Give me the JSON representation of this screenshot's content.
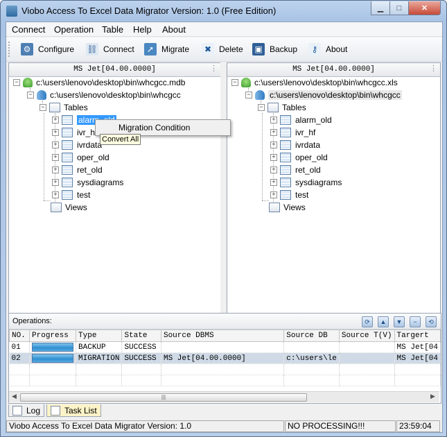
{
  "window": {
    "title": "Viobo Access To Excel Data Migrator Version: 1.0  (Free Edition)",
    "min_glyph": "▁",
    "max_glyph": "□",
    "close_glyph": "✕"
  },
  "menu": [
    "Connect",
    "Operation",
    "Table",
    "Help",
    "About"
  ],
  "toolbar": [
    {
      "label": "Configure",
      "icon": "gear-icon",
      "glyph": "⚙"
    },
    {
      "label": "Connect",
      "icon": "link-icon",
      "glyph": "⛓"
    },
    {
      "label": "Migrate",
      "icon": "migrate-icon",
      "glyph": "➚"
    },
    {
      "label": "Delete",
      "icon": "delete-icon",
      "glyph": "✖"
    },
    {
      "label": "Backup",
      "icon": "disk-icon",
      "glyph": "▣"
    },
    {
      "label": "About",
      "icon": "key-icon",
      "glyph": "⚷"
    }
  ],
  "left_panel": {
    "header": "MS Jet[04.00.0000]",
    "root": "c:\\users\\lenovo\\desktop\\bin\\whcgcc.mdb",
    "db": "c:\\users\\lenovo\\desktop\\bin\\whcgcc",
    "tables_label": "Tables",
    "tables": [
      "alarm_old",
      "ivr_hf",
      "ivrdata",
      "oper_old",
      "ret_old",
      "sysdiagrams",
      "test"
    ],
    "visible_tables": [
      "alarm_old",
      "ivr_hf",
      "ivrdata",
      "oper_old",
      "ret_old",
      "sysdiagrams",
      "test"
    ],
    "views_label": "Views"
  },
  "right_panel": {
    "header": "MS Jet[04.00.0000]",
    "root": "c:\\users\\lenovo\\desktop\\bin\\whcgcc.xls",
    "db": "c:\\users\\lenovo\\desktop\\bin\\whcgcc",
    "tables_label": "Tables",
    "tables": [
      "alarm_old",
      "ivr_hf",
      "ivrdata",
      "oper_old",
      "ret_old",
      "sysdiagrams",
      "test"
    ],
    "views_label": "Views"
  },
  "context_menu": {
    "item": "Migration Condition"
  },
  "tooltip": "Convert All",
  "operations": {
    "title": "Operations:",
    "columns": [
      "NO.",
      "Progress",
      "Type",
      "State",
      "Source DBMS",
      "Source DB",
      "Source T(V)",
      "Targert"
    ],
    "rows": [
      {
        "no": "01",
        "progress": 1.0,
        "type": "BACKUP",
        "state": "SUCCESS",
        "source_dbms": "",
        "source_db": "",
        "source_tv": "",
        "target": "MS Jet[04"
      },
      {
        "no": "02",
        "progress": 1.0,
        "type": "MIGRATION",
        "state": "SUCCESS",
        "source_dbms": "MS Jet[04.00.0000]",
        "source_db": "c:\\users\\le",
        "source_tv": "",
        "target": "MS Jet[04"
      }
    ],
    "scroll_thumb": "|||"
  },
  "tabs": [
    {
      "label": "Log",
      "active": false
    },
    {
      "label": "Task List",
      "active": true
    }
  ],
  "status": {
    "app": "Viobo Access To Excel Data Migrator Version: 1.0",
    "processing": "NO PROCESSING!!!",
    "time": "23:59:04"
  }
}
